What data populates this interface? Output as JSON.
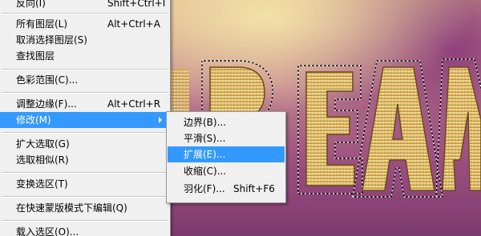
{
  "menu": {
    "items": [
      {
        "label": "反向(I)",
        "shortcut": "Shift+Ctrl+I"
      },
      {
        "label": "所有图层(L)",
        "shortcut": "Alt+Ctrl+A"
      },
      {
        "label": "取消选择图层(S)",
        "shortcut": ""
      },
      {
        "label": "查找图层",
        "shortcut": ""
      },
      {
        "label": "色彩范围(C)...",
        "shortcut": ""
      },
      {
        "label": "调整边缘(F)...",
        "shortcut": "Alt+Ctrl+R"
      },
      {
        "label": "修改(M)",
        "shortcut": ""
      },
      {
        "label": "扩大选取(G)",
        "shortcut": ""
      },
      {
        "label": "选取相似(R)",
        "shortcut": ""
      },
      {
        "label": "变换选区(T)",
        "shortcut": ""
      },
      {
        "label": "在快速蒙版模式下编辑(Q)",
        "shortcut": ""
      },
      {
        "label": "载入选区(O)...",
        "shortcut": ""
      }
    ],
    "highlighted_index": 6
  },
  "submenu": {
    "items": [
      {
        "label": "边界(B)...",
        "shortcut": ""
      },
      {
        "label": "平滑(S)...",
        "shortcut": ""
      },
      {
        "label": "扩展(E)...",
        "shortcut": ""
      },
      {
        "label": "收缩(C)...",
        "shortcut": ""
      },
      {
        "label": "羽化(F)...",
        "shortcut": "Shift+F6"
      }
    ],
    "highlighted_index": 2
  },
  "canvas": {
    "art_text": "DREAM",
    "colors": {
      "highlight": "#3399ff",
      "menu_bg": "#f0f0f0",
      "gold": "#d9b45e",
      "bg_top": "#d9b48c",
      "bg_bottom": "#7d3a6f"
    }
  }
}
